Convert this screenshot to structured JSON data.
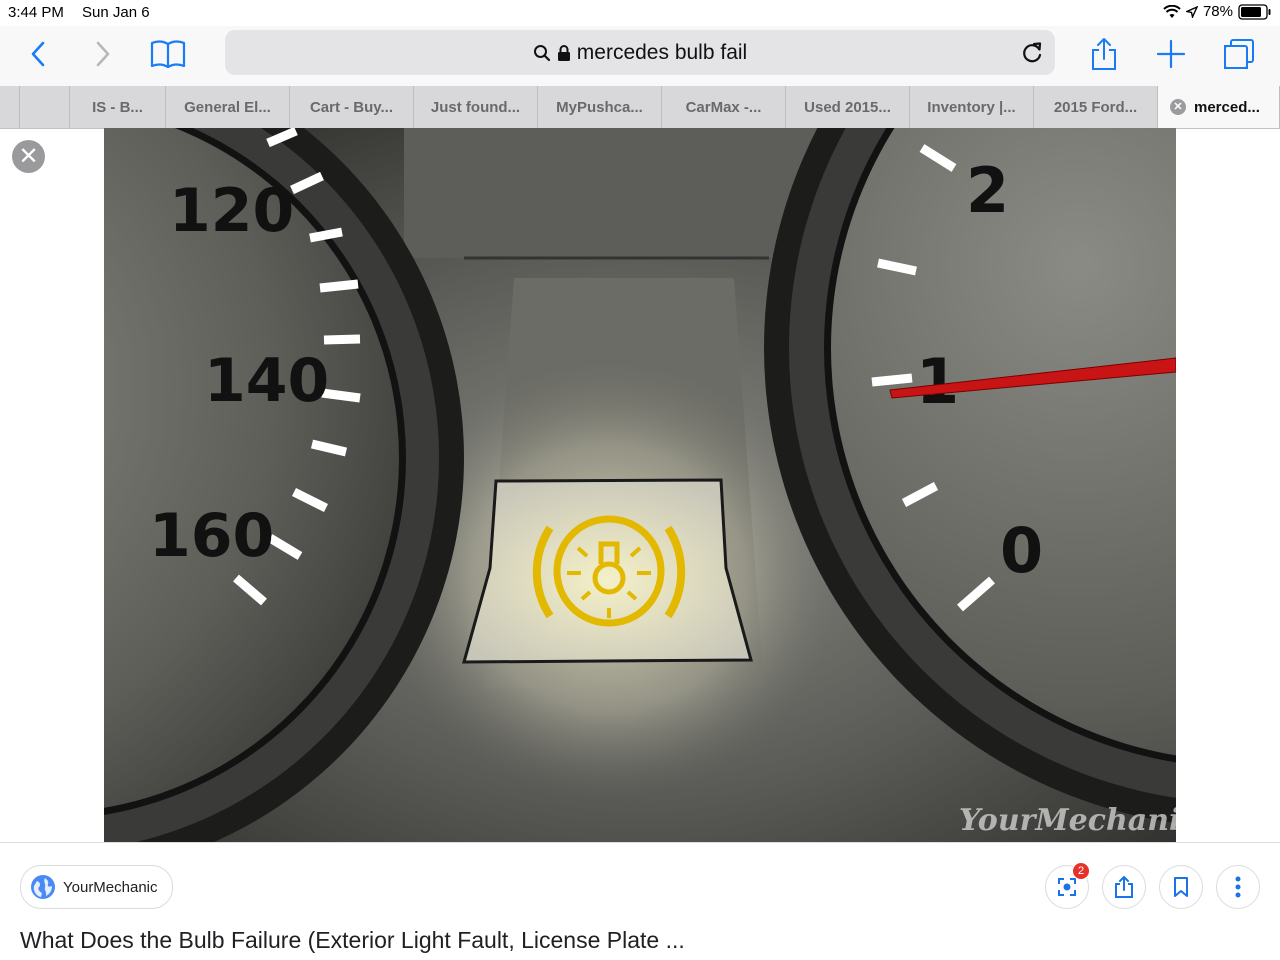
{
  "status_bar": {
    "time": "3:44 PM",
    "date": "Sun Jan 6",
    "battery": "78%"
  },
  "address_bar": {
    "text": "mercedes bulb fail"
  },
  "tabs": [
    {
      "label": ""
    },
    {
      "label": ""
    },
    {
      "label": "IS - B..."
    },
    {
      "label": "General El..."
    },
    {
      "label": "Cart - Buy..."
    },
    {
      "label": "Just found..."
    },
    {
      "label": "MyPushca..."
    },
    {
      "label": "CarMax -..."
    },
    {
      "label": "Used 2015..."
    },
    {
      "label": "Inventory |..."
    },
    {
      "label": "2015 Ford..."
    },
    {
      "label": "merced..."
    }
  ],
  "image": {
    "speedo_ticks": [
      "120",
      "140",
      "160"
    ],
    "gauge_ticks": [
      "2",
      "1",
      "0"
    ],
    "watermark": "YourMechanic"
  },
  "result": {
    "source": "YourMechanic",
    "badge_count": "2",
    "title": "What Does the Bulb Failure (Exterior Light Fault, License Plate ..."
  },
  "colors": {
    "accent": "#1a7cf5",
    "warning_light": "#f0c400",
    "needle": "#d01010"
  }
}
